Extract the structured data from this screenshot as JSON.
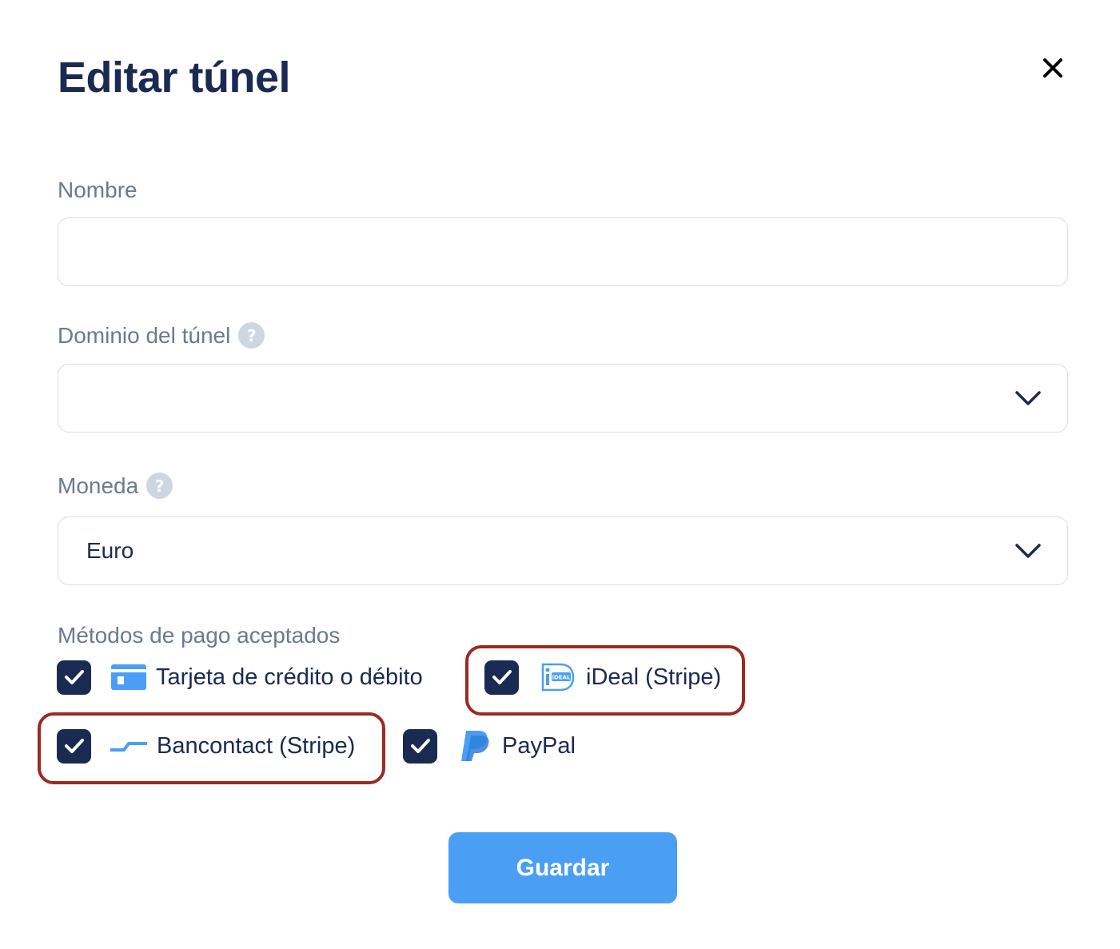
{
  "modal": {
    "title": "Editar túnel",
    "close_icon": "close-icon"
  },
  "fields": {
    "nombre": {
      "label": "Nombre",
      "value": "",
      "placeholder": ""
    },
    "dominio": {
      "label": "Dominio del túnel",
      "help_icon": "?",
      "selected": ""
    },
    "moneda": {
      "label": "Moneda",
      "help_icon": "?",
      "selected": "Euro"
    }
  },
  "payment_methods": {
    "label": "Métodos de pago aceptados",
    "items": [
      {
        "label": "Tarjeta de crédito o débito",
        "checked": true,
        "icon": "credit-card-icon"
      },
      {
        "label": "iDeal (Stripe)",
        "checked": true,
        "icon": "ideal-icon",
        "icon_text": "iDEAL"
      },
      {
        "label": "Bancontact (Stripe)",
        "checked": true,
        "icon": "bancontact-icon"
      },
      {
        "label": "PayPal",
        "checked": true,
        "icon": "paypal-icon"
      }
    ]
  },
  "actions": {
    "save_label": "Guardar"
  },
  "colors": {
    "navy": "#1b2a52",
    "label_gray": "#6b7a90",
    "accent_blue": "#4a9ff5",
    "highlight_red": "#9b2a22"
  }
}
